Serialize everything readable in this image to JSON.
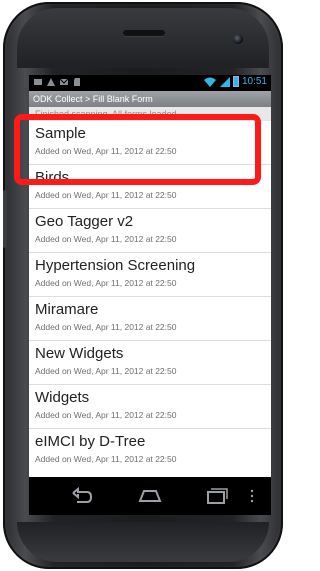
{
  "status_bar": {
    "time": "10:51",
    "left_icons": [
      "usb-icon",
      "warning-icon",
      "gmail-icon",
      "sdcard-icon"
    ],
    "right_icons": [
      "wifi-icon",
      "signal-icon",
      "battery-icon"
    ],
    "accent_color": "#33b5e5"
  },
  "title_bar": {
    "title": "ODK Collect > Fill Blank Form"
  },
  "toast": {
    "text": "Finished scanning. All forms loaded."
  },
  "forms": [
    {
      "title": "Sample",
      "subtitle": "Added on Wed, Apr 11, 2012 at 22:50"
    },
    {
      "title": "Birds",
      "subtitle": "Added on Wed, Apr 11, 2012 at 22:50"
    },
    {
      "title": "Geo Tagger v2",
      "subtitle": "Added on Wed, Apr 11, 2012 at 22:50"
    },
    {
      "title": "Hypertension Screening",
      "subtitle": "Added on Wed, Apr 11, 2012 at 22:50"
    },
    {
      "title": "Miramare",
      "subtitle": "Added on Wed, Apr 11, 2012 at 22:50"
    },
    {
      "title": "New Widgets",
      "subtitle": "Added on Wed, Apr 11, 2012 at 22:50"
    },
    {
      "title": "Widgets",
      "subtitle": "Added on Wed, Apr 11, 2012 at 22:50"
    },
    {
      "title": "eIMCI by D-Tree",
      "subtitle": "Added on Wed, Apr 11, 2012 at 22:50"
    }
  ],
  "navbar": {
    "icons": [
      "back-icon",
      "home-icon",
      "recents-icon",
      "menu-icon"
    ]
  },
  "highlight": {
    "color": "#ff1a1a"
  }
}
